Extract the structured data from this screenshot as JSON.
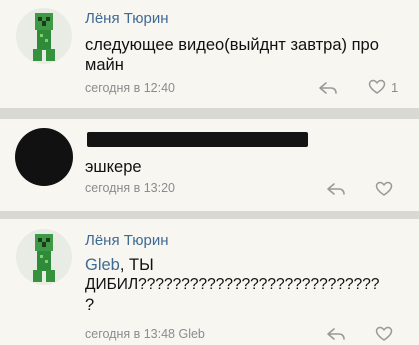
{
  "comments": [
    {
      "author": "Лёня Тюрин",
      "text": "следующее видео(выйднт завтра) про майн",
      "time": "сегодня в 12:40",
      "likes": "1"
    },
    {
      "author": "",
      "text": "эшкере",
      "time": "сегодня в 13:20"
    },
    {
      "author": "Лёня Тюрин",
      "mention": "Gleb",
      "text_after_mention": ", ТЫ",
      "text_line2": "ДИБИЛ????????????????????????????",
      "text_line3": "?",
      "time": "сегодня в 13:48",
      "reply_to": "Gleb"
    }
  ],
  "icons": {
    "reply": "reply-arrow-icon",
    "like": "heart-icon"
  },
  "colors": {
    "link": "#3f6a94",
    "meta": "#8a8c8e",
    "card": "#f7f6f1",
    "divider": "#d9d9d3"
  }
}
